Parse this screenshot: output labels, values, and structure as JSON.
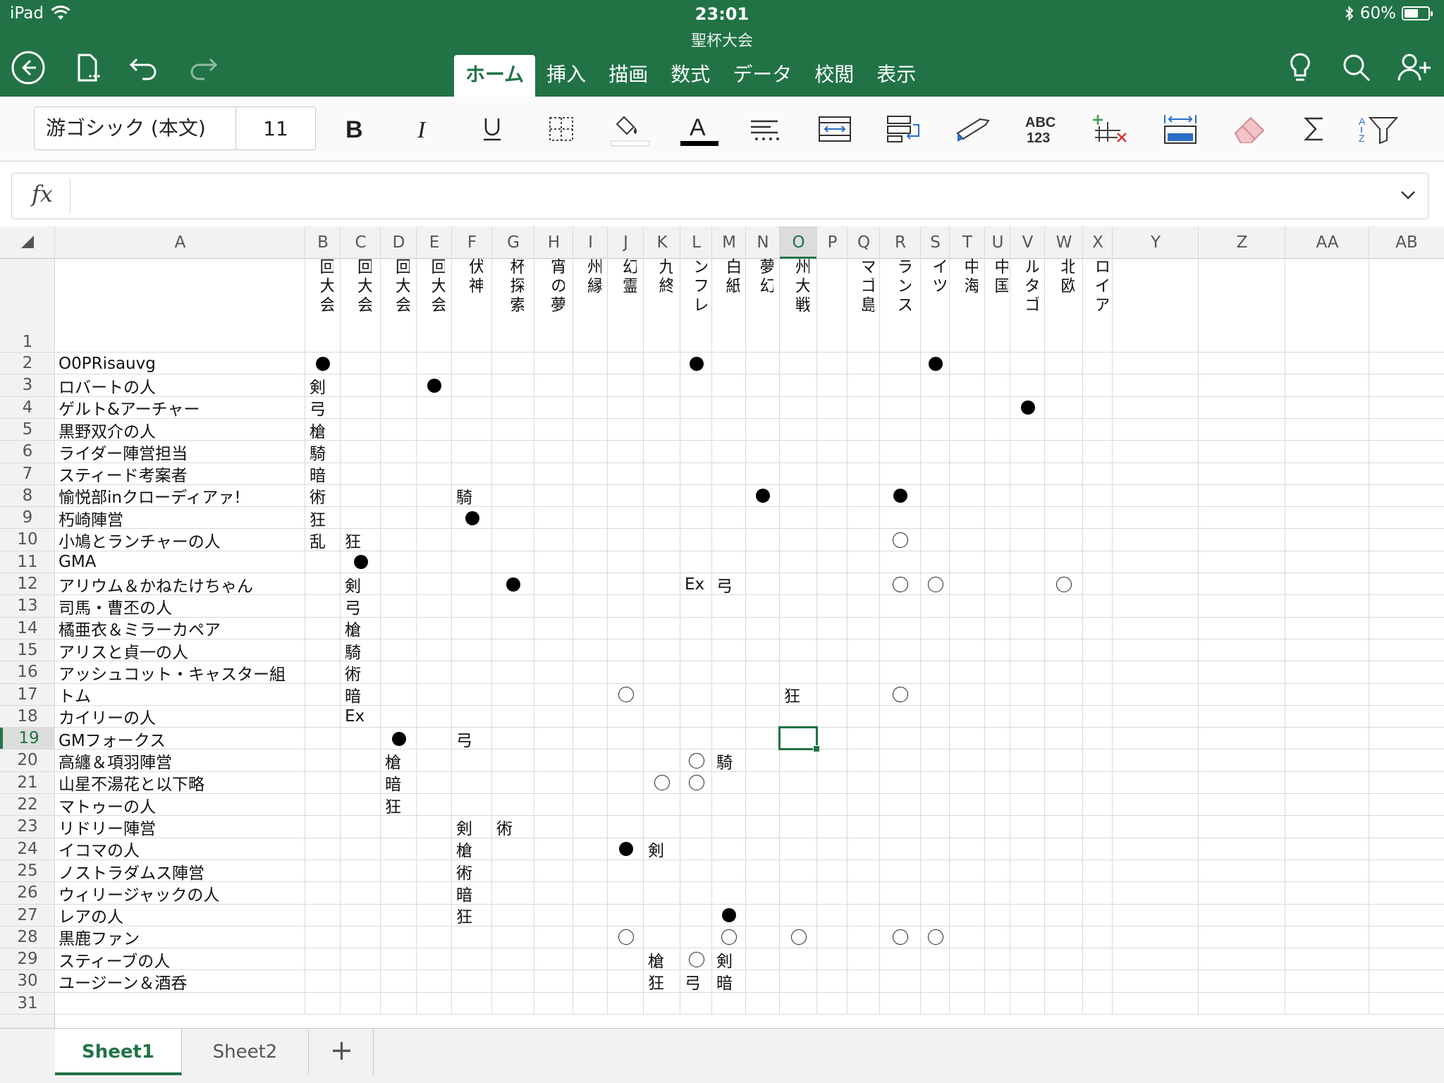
{
  "status_bar": {
    "device": "iPad",
    "time": "23:01",
    "battery": "60%",
    "battery_level": 0.6
  },
  "document": {
    "title": "聖杯大会"
  },
  "ribbon_tabs": [
    "ホーム",
    "挿入",
    "描画",
    "数式",
    "データ",
    "校閲",
    "表示"
  ],
  "active_tab": "ホーム",
  "font": {
    "name": "游ゴシック (本文)",
    "size": "11"
  },
  "formula_bar": {
    "label": "fx",
    "value": ""
  },
  "columns": [
    "A",
    "B",
    "C",
    "D",
    "E",
    "F",
    "G",
    "H",
    "I",
    "J",
    "K",
    "L",
    "M",
    "N",
    "O",
    "P",
    "Q",
    "R",
    "S",
    "T",
    "U",
    "V",
    "W",
    "X",
    "Y",
    "Z",
    "AA",
    "AB"
  ],
  "selected_column": "O",
  "selected_row": "19",
  "header_row_text": {
    "B": "回大会",
    "C": "回大会",
    "D": "回大会",
    "E": "回大会",
    "F": "伏神",
    "G": "杯探索",
    "H": "宵の夢",
    "I": "州縁",
    "J": "幻霊",
    "K": "九終",
    "L": "ンフレ",
    "M": "白紙",
    "N": "夢幻",
    "O": "州大戦",
    "Q": "マゴ島",
    "R": "ランス",
    "S": "イツ",
    "T": "中海",
    "U": "中国",
    "V": "ルタゴ",
    "W": "北欧",
    "X": "ロイア"
  },
  "row_names": {
    "2": "O0PRisauvg",
    "3": "ロバートの人",
    "4": "ゲルト&アーチャー",
    "5": "黒野双介の人",
    "6": "ライダー陣営担当",
    "7": "スティード考案者",
    "8": "愉悦部inクローディアァ!",
    "9": "朽崎陣営",
    "10": "小鳩とランチャーの人",
    "11": "GMA",
    "12": "アリウム＆かねたけちゃん",
    "13": "司馬・曹丕の人",
    "14": "橘亜衣＆ミラーカペア",
    "15": "アリスと貞一の人",
    "16": "アッシュコット・キャスター組",
    "17": "トム",
    "18": "カイリーの人",
    "19": "GMフォークス",
    "20": "高纏＆項羽陣営",
    "21": "山星不湯花と以下略",
    "22": "マトゥーの人",
    "23": "リドリー陣営",
    "24": "イコマの人",
    "25": "ノストラダムス陣営",
    "26": "ウィリージャックの人",
    "27": "レアの人",
    "28": "黒鹿ファン",
    "29": "スティーブの人",
    "30": "ユージーン＆酒呑"
  },
  "cells": [
    {
      "row": "2",
      "col": "B",
      "mark": "●"
    },
    {
      "row": "2",
      "col": "L",
      "mark": "●"
    },
    {
      "row": "2",
      "col": "S",
      "mark": "●"
    },
    {
      "row": "3",
      "col": "B",
      "mark": "剣"
    },
    {
      "row": "3",
      "col": "E",
      "mark": "●"
    },
    {
      "row": "4",
      "col": "B",
      "mark": "弓"
    },
    {
      "row": "4",
      "col": "V",
      "mark": "●"
    },
    {
      "row": "5",
      "col": "B",
      "mark": "槍"
    },
    {
      "row": "6",
      "col": "B",
      "mark": "騎"
    },
    {
      "row": "7",
      "col": "B",
      "mark": "暗"
    },
    {
      "row": "8",
      "col": "B",
      "mark": "術"
    },
    {
      "row": "8",
      "col": "F",
      "mark": "騎"
    },
    {
      "row": "8",
      "col": "N",
      "mark": "●"
    },
    {
      "row": "8",
      "col": "R",
      "mark": "●"
    },
    {
      "row": "9",
      "col": "B",
      "mark": "狂"
    },
    {
      "row": "9",
      "col": "F",
      "mark": "●"
    },
    {
      "row": "10",
      "col": "B",
      "mark": "乱"
    },
    {
      "row": "10",
      "col": "C",
      "mark": "狂"
    },
    {
      "row": "10",
      "col": "R",
      "mark": "○"
    },
    {
      "row": "11",
      "col": "C",
      "mark": "●"
    },
    {
      "row": "12",
      "col": "C",
      "mark": "剣"
    },
    {
      "row": "12",
      "col": "G",
      "mark": "●"
    },
    {
      "row": "12",
      "col": "L",
      "mark": "Ex"
    },
    {
      "row": "12",
      "col": "M",
      "mark": "弓"
    },
    {
      "row": "12",
      "col": "R",
      "mark": "○"
    },
    {
      "row": "12",
      "col": "S",
      "mark": "○"
    },
    {
      "row": "12",
      "col": "W",
      "mark": "○"
    },
    {
      "row": "13",
      "col": "C",
      "mark": "弓"
    },
    {
      "row": "14",
      "col": "C",
      "mark": "槍"
    },
    {
      "row": "15",
      "col": "C",
      "mark": "騎"
    },
    {
      "row": "16",
      "col": "C",
      "mark": "術"
    },
    {
      "row": "17",
      "col": "C",
      "mark": "暗"
    },
    {
      "row": "17",
      "col": "J",
      "mark": "○"
    },
    {
      "row": "17",
      "col": "O",
      "mark": "狂"
    },
    {
      "row": "17",
      "col": "R",
      "mark": "○"
    },
    {
      "row": "18",
      "col": "C",
      "mark": "Ex"
    },
    {
      "row": "19",
      "col": "D",
      "mark": "●"
    },
    {
      "row": "19",
      "col": "F",
      "mark": "弓"
    },
    {
      "row": "20",
      "col": "D",
      "mark": "槍"
    },
    {
      "row": "20",
      "col": "L",
      "mark": "○"
    },
    {
      "row": "20",
      "col": "M",
      "mark": "騎"
    },
    {
      "row": "21",
      "col": "D",
      "mark": "暗"
    },
    {
      "row": "21",
      "col": "K",
      "mark": "○"
    },
    {
      "row": "21",
      "col": "L",
      "mark": "○"
    },
    {
      "row": "22",
      "col": "D",
      "mark": "狂"
    },
    {
      "row": "23",
      "col": "F",
      "mark": "剣"
    },
    {
      "row": "23",
      "col": "G",
      "mark": "術"
    },
    {
      "row": "24",
      "col": "F",
      "mark": "槍"
    },
    {
      "row": "24",
      "col": "J",
      "mark": "●"
    },
    {
      "row": "24",
      "col": "K",
      "mark": "剣"
    },
    {
      "row": "25",
      "col": "F",
      "mark": "術"
    },
    {
      "row": "26",
      "col": "F",
      "mark": "暗"
    },
    {
      "row": "27",
      "col": "F",
      "mark": "狂"
    },
    {
      "row": "27",
      "col": "M",
      "mark": "●"
    },
    {
      "row": "28",
      "col": "J",
      "mark": "○"
    },
    {
      "row": "28",
      "col": "M",
      "mark": "○"
    },
    {
      "row": "28",
      "col": "O",
      "mark": "○"
    },
    {
      "row": "28",
      "col": "R",
      "mark": "○"
    },
    {
      "row": "28",
      "col": "S",
      "mark": "○"
    },
    {
      "row": "29",
      "col": "K",
      "mark": "槍"
    },
    {
      "row": "29",
      "col": "L",
      "mark": "○"
    },
    {
      "row": "29",
      "col": "M",
      "mark": "剣"
    },
    {
      "row": "30",
      "col": "K",
      "mark": "狂"
    },
    {
      "row": "30",
      "col": "L",
      "mark": "弓"
    },
    {
      "row": "30",
      "col": "M",
      "mark": "暗"
    }
  ],
  "sheets": [
    "Sheet1",
    "Sheet2"
  ],
  "active_sheet": "Sheet1",
  "add_sheet_label": "+",
  "icons": [
    "back-icon",
    "file-icon",
    "undo-icon",
    "redo-icon",
    "lightbulb-icon",
    "search-icon",
    "share-person-icon",
    "bold-icon",
    "italic-icon",
    "underline-icon",
    "borders-icon",
    "fill-color-icon",
    "font-color-icon",
    "align-icon",
    "merge-icon",
    "wrap-icon",
    "format-painter-icon",
    "number-format-icon",
    "insert-delete-icon",
    "autofit-icon",
    "eraser-icon",
    "sum-icon",
    "sort-filter-icon",
    "chevron-down-icon"
  ],
  "colors": {
    "excel_green": "#217346",
    "fill_underline": "#ffffff",
    "font_underline": "#000000"
  }
}
